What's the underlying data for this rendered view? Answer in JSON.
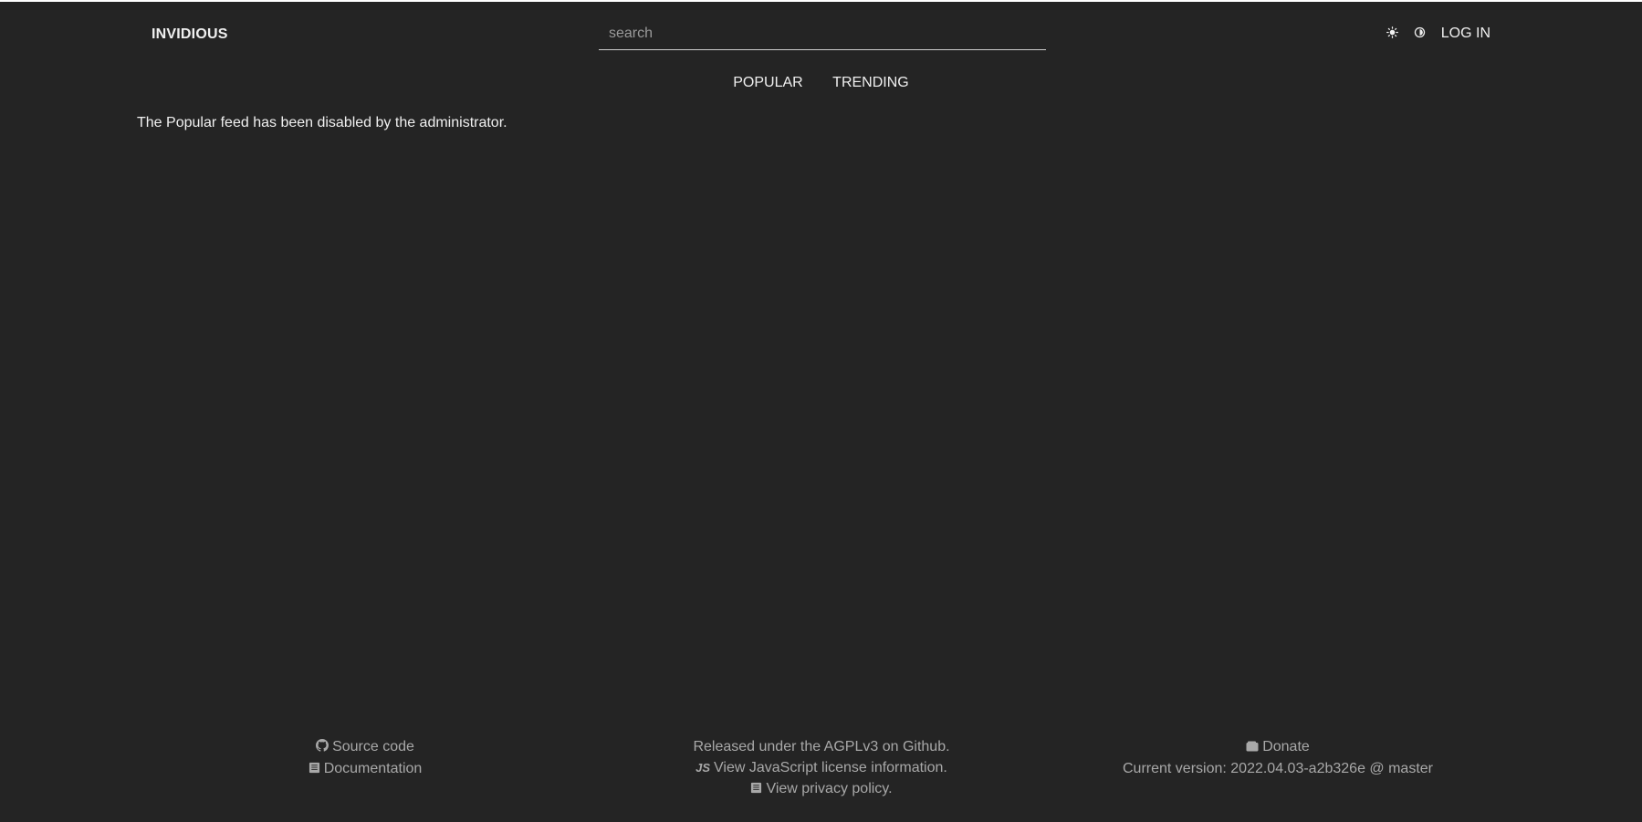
{
  "header": {
    "brand": "INVIDIOUS",
    "search": {
      "placeholder": "search",
      "value": ""
    },
    "theme_icons": [
      "sun-icon",
      "half-moon-icon"
    ],
    "login_label": "LOG IN"
  },
  "feed_menu": {
    "items": [
      {
        "label": "POPULAR"
      },
      {
        "label": "TRENDING"
      }
    ]
  },
  "main": {
    "message": "The Popular feed has been disabled by the administrator."
  },
  "footer": {
    "left": {
      "source_code": "Source code",
      "documentation": "Documentation"
    },
    "middle": {
      "license": "Released under the AGPLv3 on Github.",
      "js_license": "View JavaScript license information.",
      "js_badge": "JS",
      "privacy": "View privacy policy."
    },
    "right": {
      "donate": "Donate",
      "version": "Current version: 2022.04.03-a2b326e @ master"
    }
  },
  "colors": {
    "background": "#242424",
    "text": "#f0f0f0",
    "muted": "#a8a8a8"
  }
}
